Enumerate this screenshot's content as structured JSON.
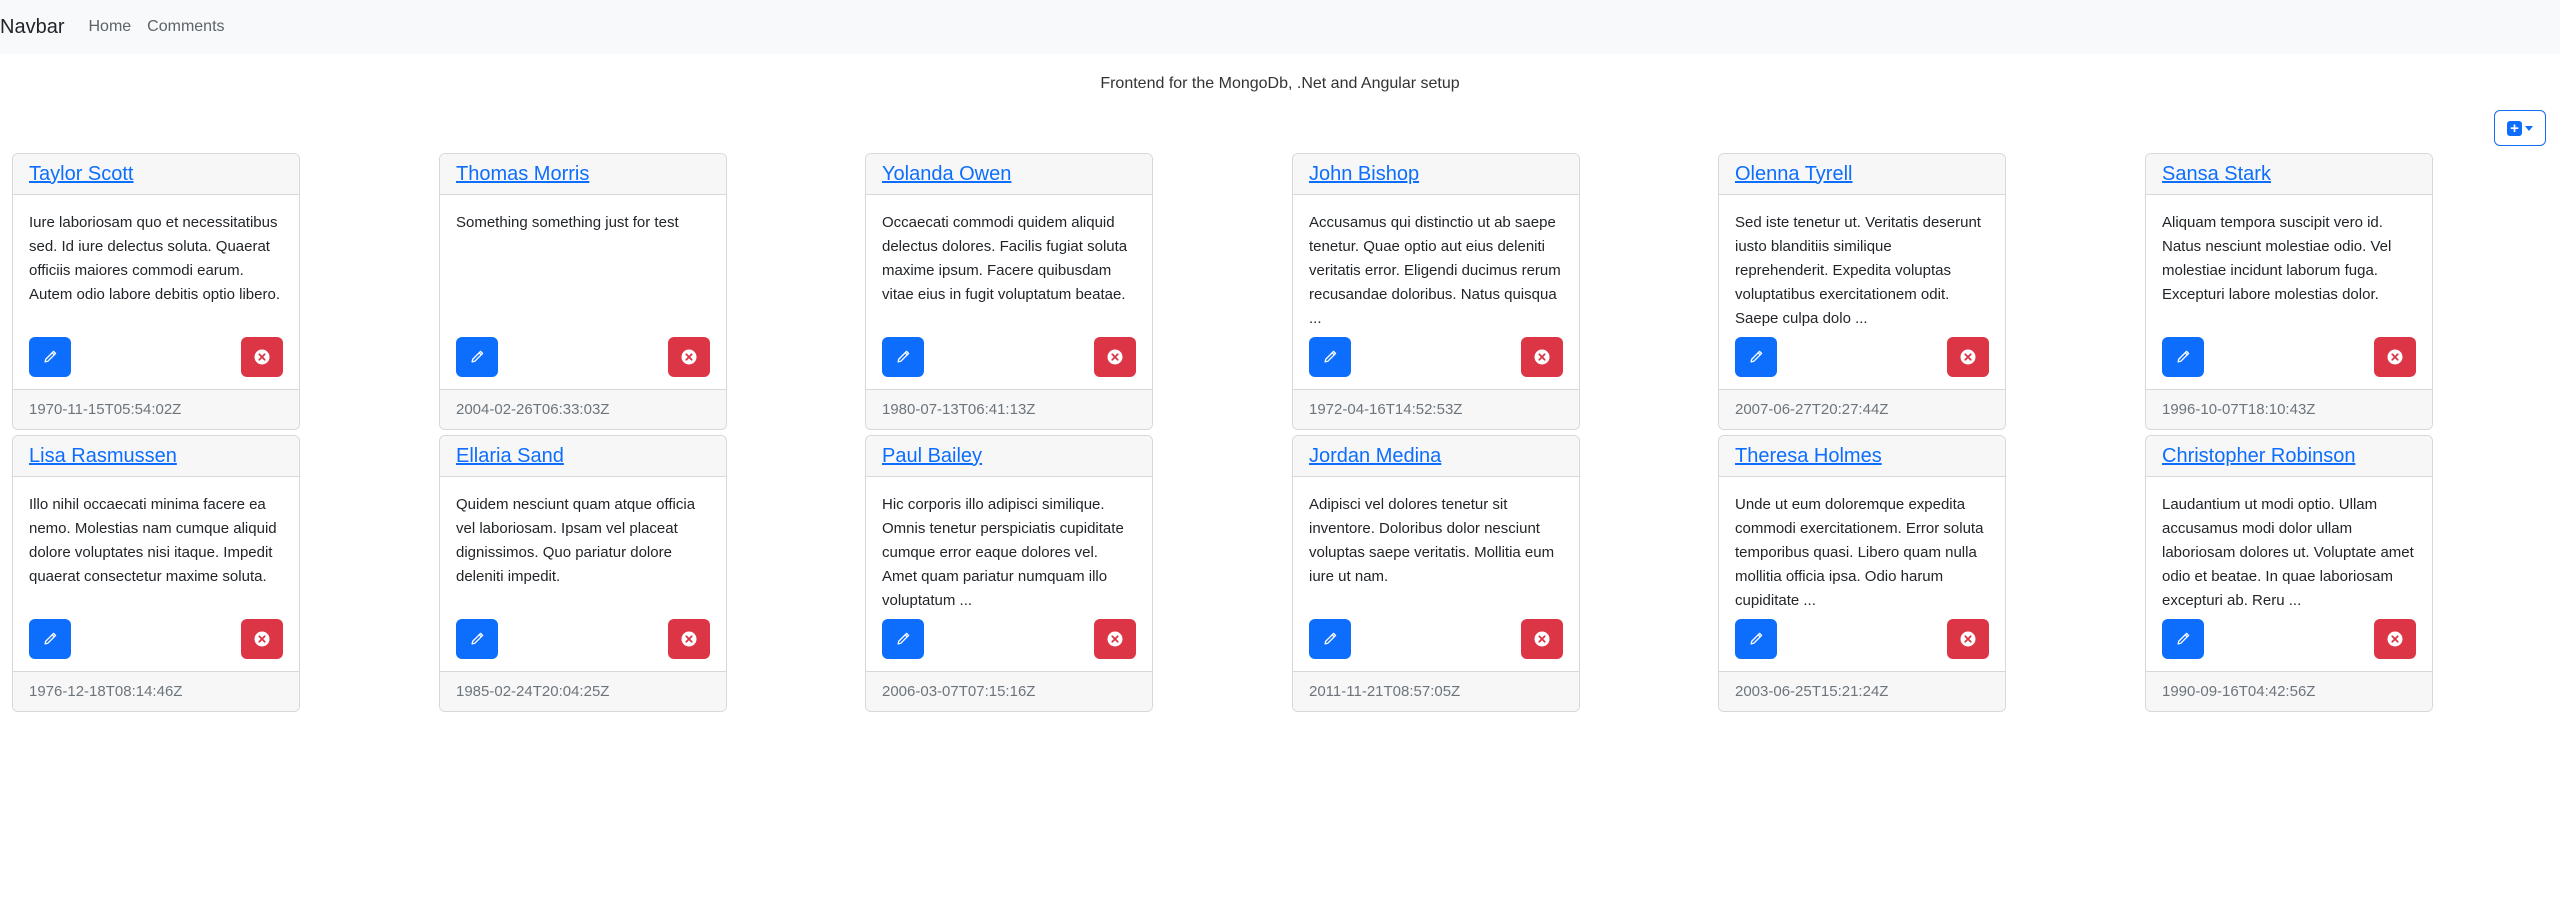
{
  "navbar": {
    "brand": "Navbar",
    "links": [
      "Home",
      "Comments"
    ]
  },
  "subtitle": "Frontend for the MongoDb, .Net and Angular setup",
  "colors": {
    "primary": "#0d6efd",
    "danger": "#dc3545"
  },
  "icons": {
    "add": "plus-square-icon",
    "edit": "pencil-icon",
    "delete": "x-circle-icon"
  },
  "cards": [
    {
      "name": "Taylor Scott",
      "text": "Iure laboriosam quo et necessitatibus sed. Id iure delectus soluta. Quaerat officiis maiores commodi earum. Autem odio labore debitis optio libero.",
      "date": "1970-11-15T05:54:02Z"
    },
    {
      "name": "Thomas Morris",
      "text": "Something something just for test",
      "date": "2004-02-26T06:33:03Z"
    },
    {
      "name": "Yolanda Owen",
      "text": "Occaecati commodi quidem aliquid delectus dolores. Facilis fugiat soluta maxime ipsum. Facere quibusdam vitae eius in fugit voluptatum beatae.",
      "date": "1980-07-13T06:41:13Z"
    },
    {
      "name": "John Bishop",
      "text": "Accusamus qui distinctio ut ab saepe tenetur. Quae optio aut eius deleniti veritatis error. Eligendi ducimus rerum recusandae doloribus. Natus quisqua ...",
      "date": "1972-04-16T14:52:53Z"
    },
    {
      "name": "Olenna Tyrell",
      "text": "Sed iste tenetur ut. Veritatis deserunt iusto blanditiis similique reprehenderit. Expedita voluptas voluptatibus exercitationem odit. Saepe culpa dolo ...",
      "date": "2007-06-27T20:27:44Z"
    },
    {
      "name": "Sansa Stark",
      "text": "Aliquam tempora suscipit vero id. Natus nesciunt molestiae odio. Vel molestiae incidunt laborum fuga. Excepturi labore molestias dolor.",
      "date": "1996-10-07T18:10:43Z"
    },
    {
      "name": "Lisa Rasmussen",
      "text": "Illo nihil occaecati minima facere ea nemo. Molestias nam cumque aliquid dolore voluptates nisi itaque. Impedit quaerat consectetur maxime soluta.",
      "date": "1976-12-18T08:14:46Z"
    },
    {
      "name": "Ellaria Sand",
      "text": "Quidem nesciunt quam atque officia vel laboriosam. Ipsam vel placeat dignissimos. Quo pariatur dolore deleniti impedit.",
      "date": "1985-02-24T20:04:25Z"
    },
    {
      "name": "Paul Bailey",
      "text": "Hic corporis illo adipisci similique. Omnis tenetur perspiciatis cupiditate cumque error eaque dolores vel. Amet quam pariatur numquam illo voluptatum ...",
      "date": "2006-03-07T07:15:16Z"
    },
    {
      "name": "Jordan Medina",
      "text": "Adipisci vel dolores tenetur sit inventore. Doloribus dolor nesciunt voluptas saepe veritatis. Mollitia eum iure ut nam.",
      "date": "2011-11-21T08:57:05Z"
    },
    {
      "name": "Theresa Holmes",
      "text": "Unde ut eum doloremque expedita commodi exercitationem. Error soluta temporibus quasi. Libero quam nulla mollitia officia ipsa. Odio harum cupiditate ...",
      "date": "2003-06-25T15:21:24Z"
    },
    {
      "name": "Christopher Robinson",
      "text": "Laudantium ut modi optio. Ullam accusamus modi dolor ullam laboriosam dolores ut. Voluptate amet odio et beatae. In quae laboriosam excepturi ab. Reru ...",
      "date": "1990-09-16T04:42:56Z"
    }
  ]
}
